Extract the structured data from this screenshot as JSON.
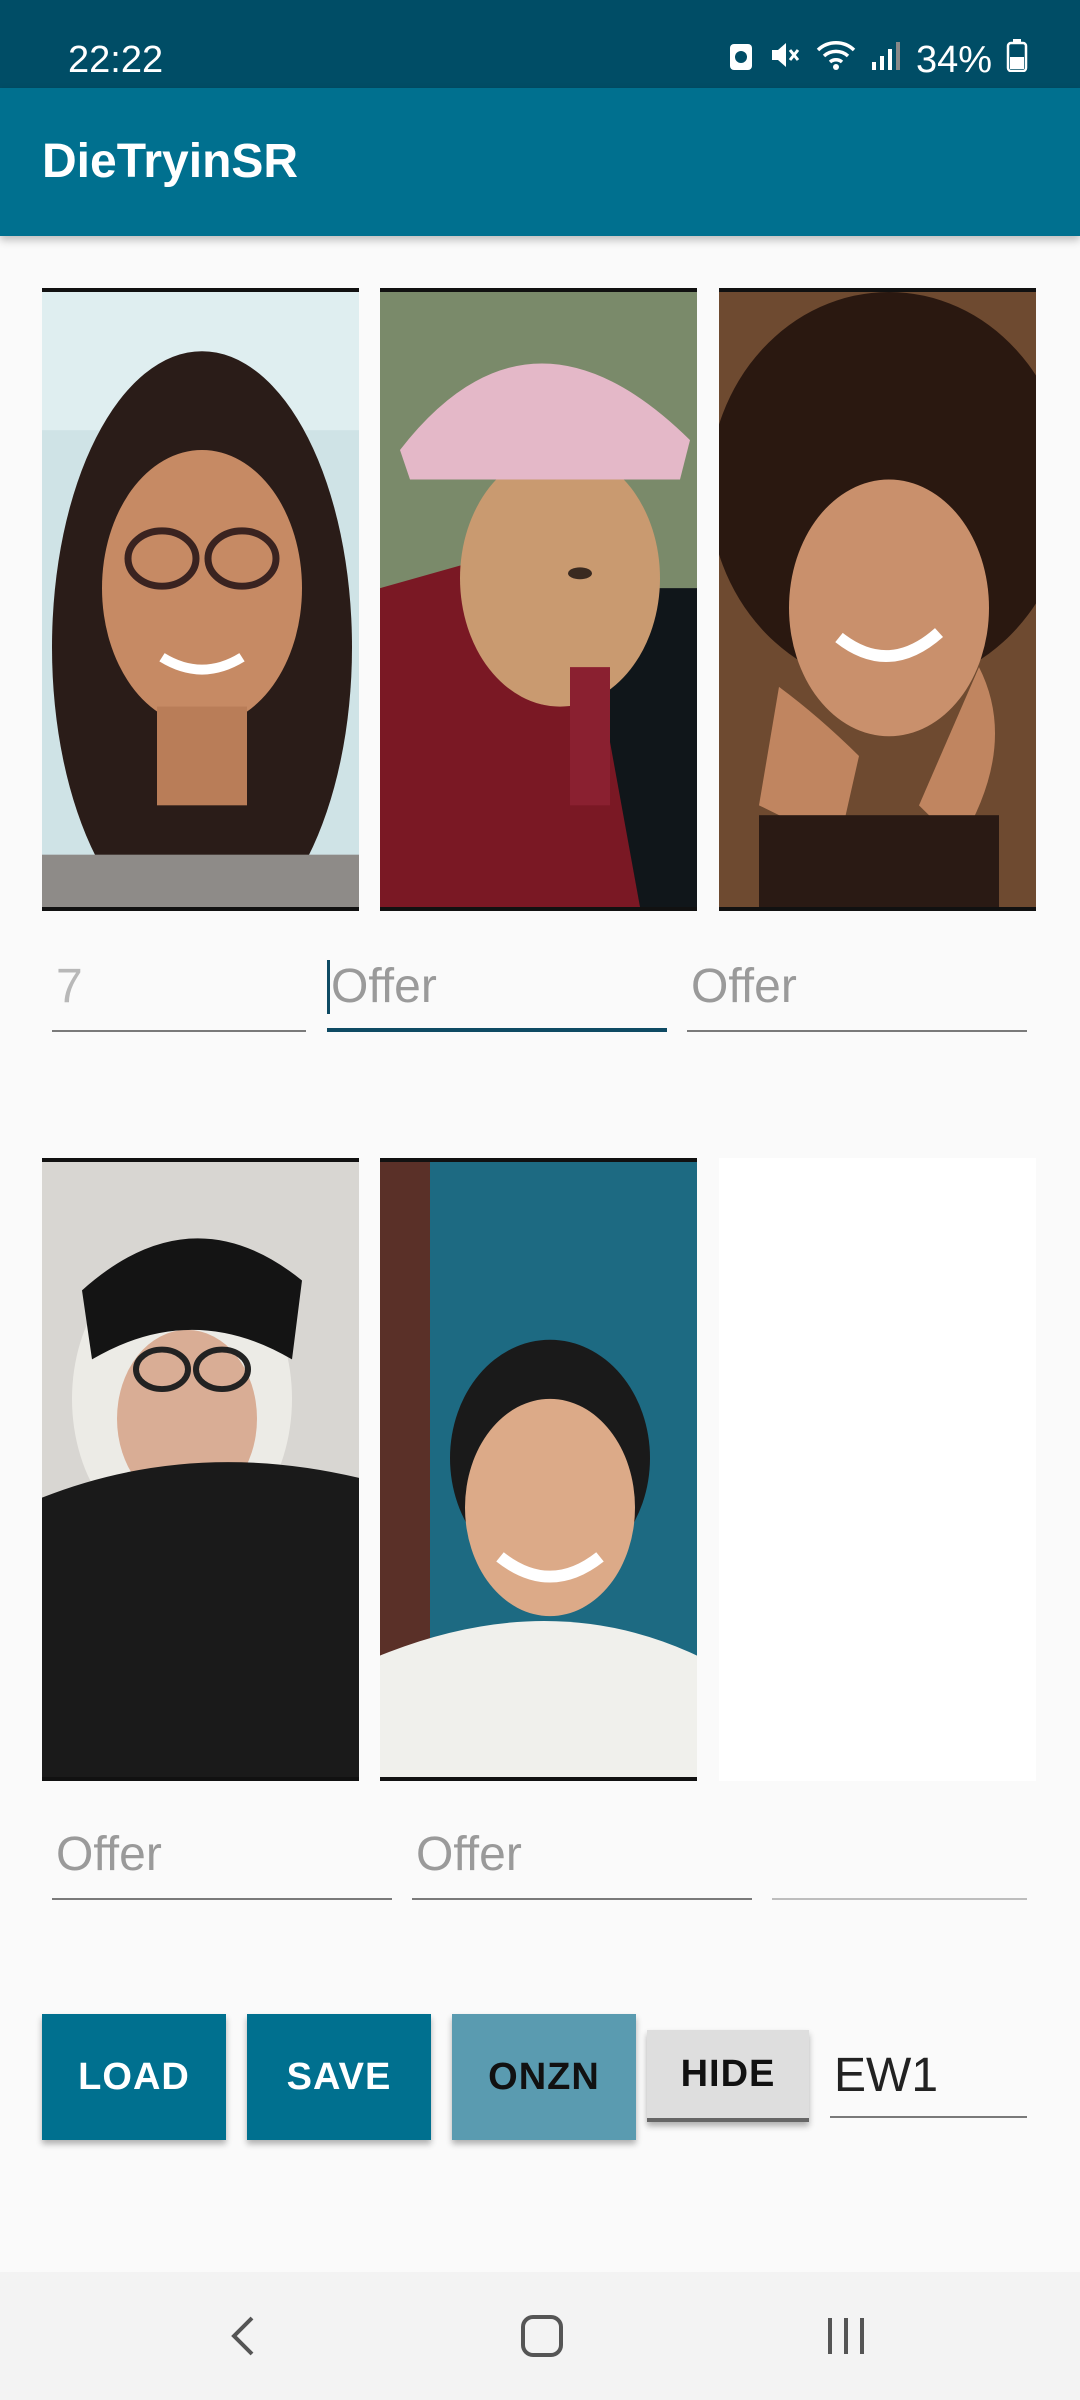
{
  "status_bar": {
    "time": "22:22",
    "battery": "34%",
    "icons": [
      "notification-badge-icon",
      "mute-icon",
      "wifi-icon",
      "signal-icon",
      "battery-icon"
    ]
  },
  "app_bar": {
    "title": "DieTryinSR"
  },
  "row1": {
    "fields": [
      {
        "value": "7",
        "state": "hint"
      },
      {
        "value": "Offer",
        "state": "focused"
      },
      {
        "value": "Offer",
        "state": "hint"
      }
    ]
  },
  "row2": {
    "fields": [
      {
        "value": "Offer",
        "state": "hint"
      },
      {
        "value": "Offer",
        "state": "hint"
      },
      {
        "value": "",
        "state": "empty"
      }
    ]
  },
  "buttons": {
    "load": "LOAD",
    "save": "SAVE",
    "onzn": "ONZN",
    "hide": "HIDE"
  },
  "code_field": {
    "value": "EW1"
  },
  "colors": {
    "status_bar": "#004d66",
    "app_bar": "#00708f",
    "primary_button": "#00708f",
    "secondary_button": "#5a9bb0"
  },
  "nav_bar": {
    "icons": [
      "back-icon",
      "home-icon",
      "recents-icon"
    ]
  }
}
